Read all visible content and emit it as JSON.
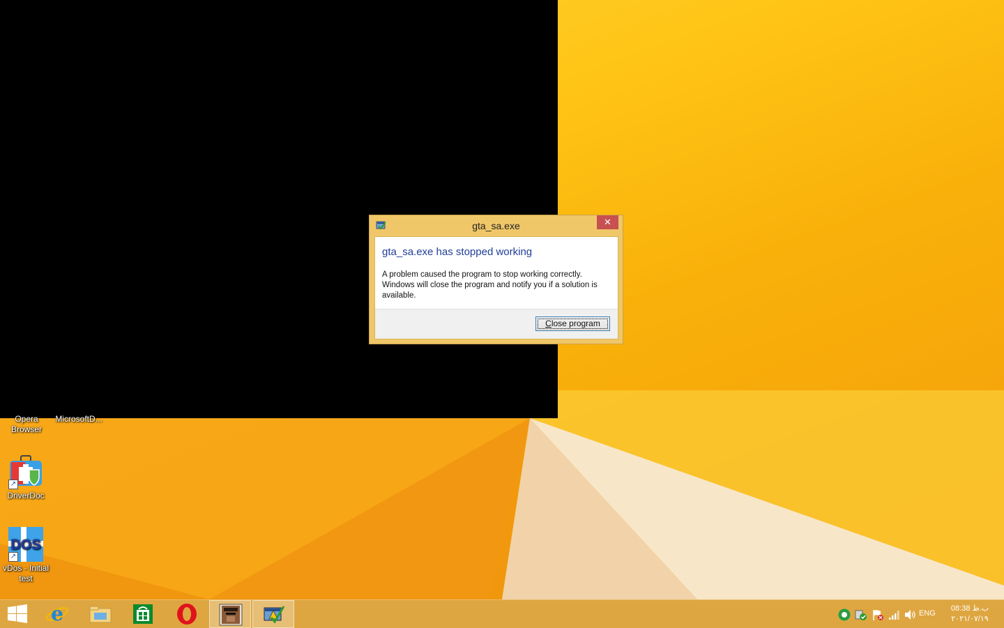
{
  "dialog": {
    "title": "gta_sa.exe",
    "heading": "gta_sa.exe has stopped working",
    "message_line1": "A problem caused the program to stop working correctly.",
    "message_line2": "Windows will close the program and notify you if a solution is available.",
    "close_button_accel": "C",
    "close_button_rest": "lose program",
    "close_glyph": "✕"
  },
  "desktop": {
    "icons": [
      {
        "label_line1": "Opera",
        "label_line2": "Browser"
      },
      {
        "label_line1": "MicrosoftD..."
      },
      {
        "label_line1": "DriverDoc"
      },
      {
        "label_line1": "vDos - Initial",
        "label_line2": "test"
      }
    ]
  },
  "tray": {
    "language": "ENG",
    "time": "08:38 ب.ظ",
    "date": "۲۰۲۱/۰۷/۱۹"
  },
  "colors": {
    "accent": "#f0c768",
    "close": "#c75050",
    "heading": "#1f3e96",
    "taskbar": "#dea640"
  }
}
